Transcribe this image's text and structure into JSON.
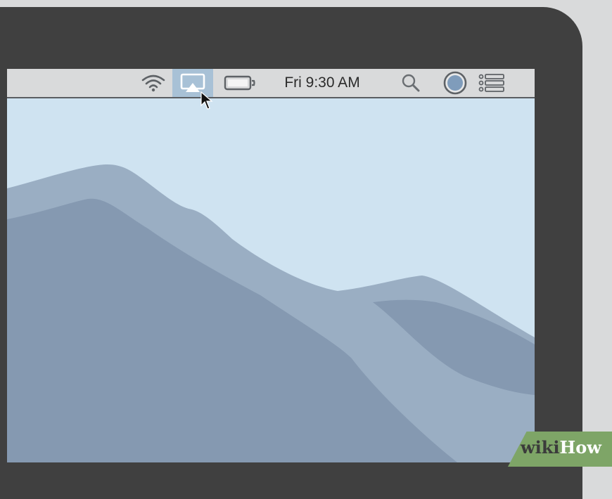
{
  "menubar": {
    "clock": "Fri 9:30 AM",
    "icons": [
      "wifi-icon",
      "airplay-icon",
      "battery-icon",
      "search-icon",
      "siri-icon",
      "notification-center-icon"
    ],
    "highlight_color": "#a8c1d6"
  },
  "wallpaper": {
    "sky_color": "#cfe3f1",
    "mountain_colors": [
      "#9aaec3",
      "#8599b1"
    ]
  },
  "watermark": {
    "part1": "wiki",
    "part2": "How"
  }
}
